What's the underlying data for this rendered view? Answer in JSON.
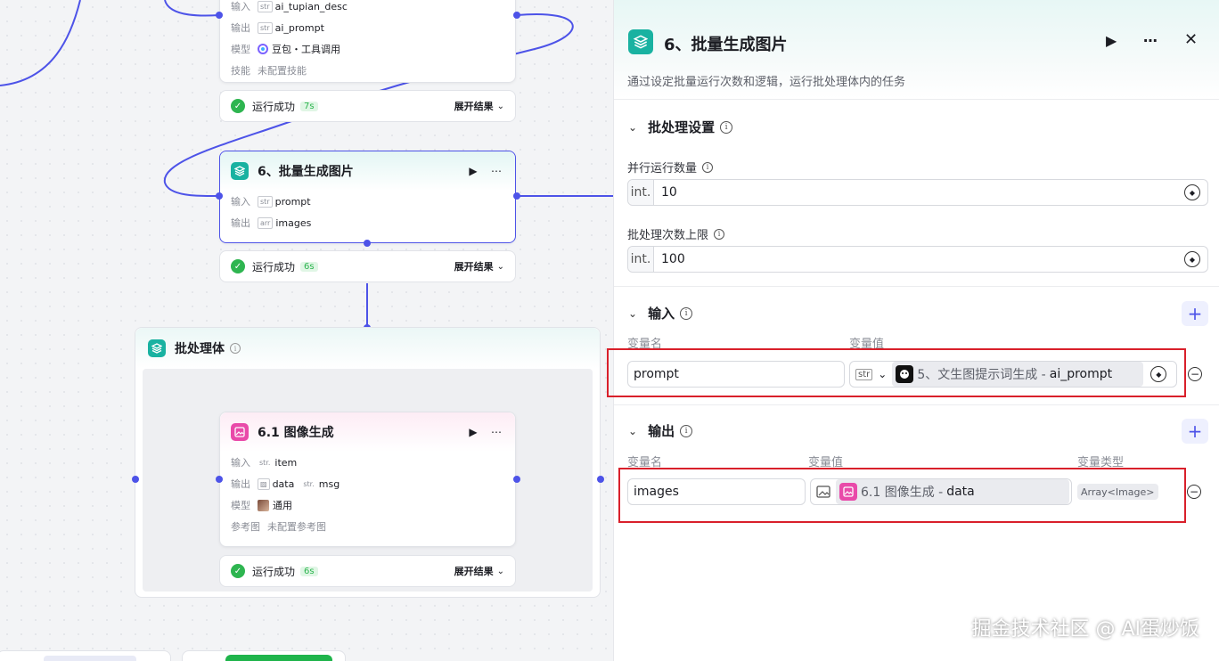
{
  "canvas": {
    "top_node": {
      "input_label": "输入",
      "input_var": "ai_tupian_desc",
      "output_label": "输出",
      "output_var": "ai_prompt",
      "model_label": "模型",
      "model_value": "豆包・工具调用",
      "skill_label": "技能",
      "skill_value": "未配置技能",
      "status": "运行成功",
      "time": "7s",
      "expand": "展开结果"
    },
    "batch_node": {
      "title": "6、批量生成图片",
      "input_label": "输入",
      "input_var": "prompt",
      "output_label": "输出",
      "output_var": "images",
      "status": "运行成功",
      "time": "6s",
      "expand": "展开结果"
    },
    "group": {
      "title": "批处理体"
    },
    "image_node": {
      "title": "6.1 图像生成",
      "input_label": "输入",
      "input_var": "item",
      "output_label": "输出",
      "output_var1": "data",
      "output_var2": "msg",
      "model_label": "模型",
      "model_value": "通用",
      "ref_label": "参考图",
      "ref_value": "未配置参考图",
      "status": "运行成功",
      "time": "6s",
      "expand": "展开结果"
    }
  },
  "panel": {
    "title": "6、批量生成图片",
    "description": "通过设定批量运行次数和逻辑，运行批处理体内的任务",
    "batch_settings": {
      "title": "批处理设置",
      "parallel_label": "并行运行数量",
      "parallel_prefix": "int.",
      "parallel_value": "10",
      "limit_label": "批处理次数上限",
      "limit_prefix": "int.",
      "limit_value": "100"
    },
    "inputs": {
      "title": "输入",
      "col_name": "变量名",
      "col_value": "变量值",
      "row": {
        "name": "prompt",
        "type": "str",
        "ref_source": "5、文生图提示词生成 -",
        "ref_var": "ai_prompt"
      }
    },
    "outputs": {
      "title": "输出",
      "col_name": "变量名",
      "col_value": "变量值",
      "col_type": "变量类型",
      "row": {
        "name": "images",
        "ref_source": "6.1 图像生成 -",
        "ref_var": "data",
        "var_type": "Array<Image>"
      }
    }
  },
  "watermark": "掘金技术社区 @ AI蛋炒饭",
  "colors": {
    "accent": "#4d53e8",
    "teal": "#19b2a1",
    "pink": "#e94aa9",
    "success": "#2eb550",
    "highlight": "#d9202b"
  }
}
